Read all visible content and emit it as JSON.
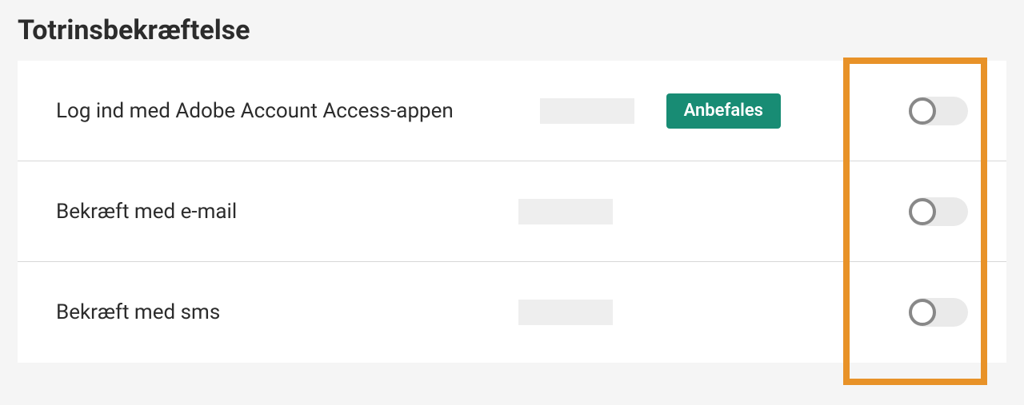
{
  "section_title": "Totrinsbekræftelse",
  "rows": [
    {
      "label": "Log ind med Adobe Account Access-appen",
      "badge": "Anbefales",
      "has_badge": true
    },
    {
      "label": "Bekræft med e-mail",
      "has_badge": false
    },
    {
      "label": "Bekræft med sms",
      "has_badge": false
    }
  ],
  "colors": {
    "badge_bg": "#188c74",
    "highlight_border": "#e89228"
  }
}
